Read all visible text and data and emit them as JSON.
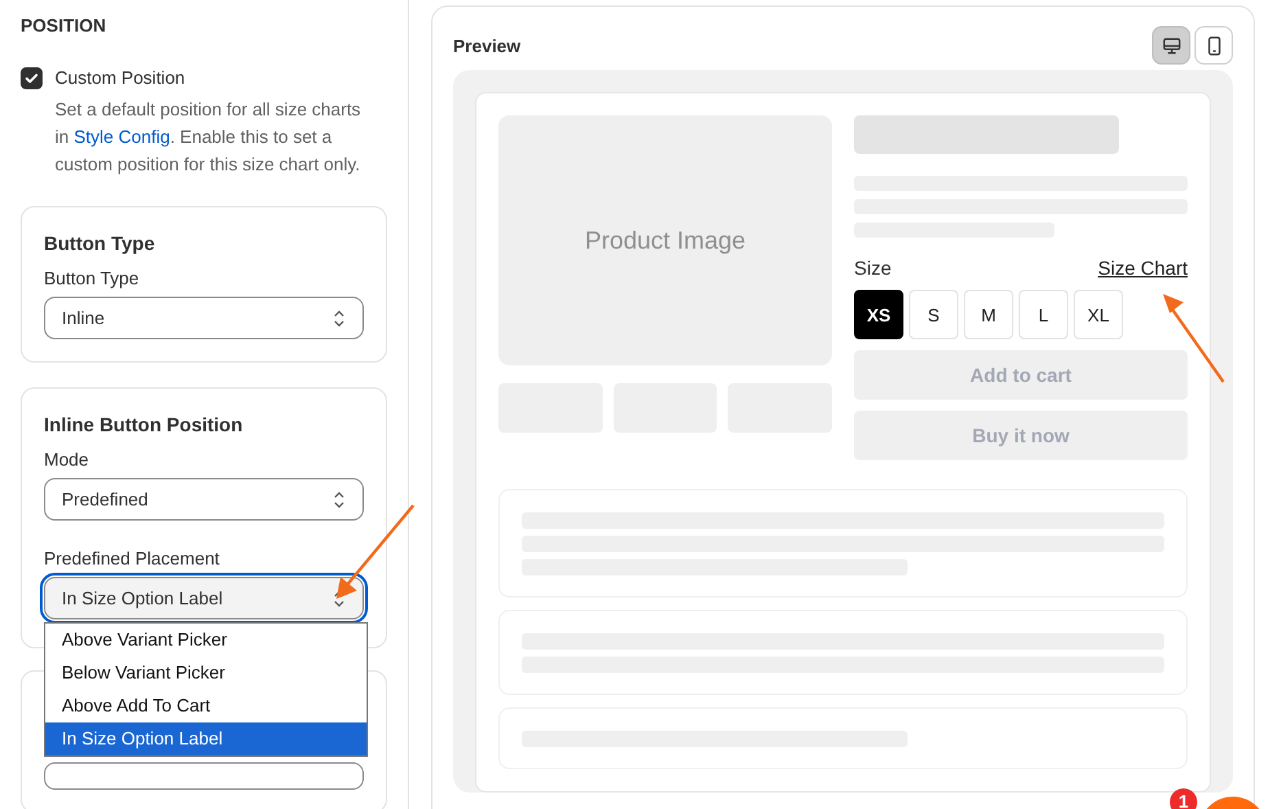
{
  "settings": {
    "section_title": "POSITION",
    "custom_position": {
      "label": "Custom Position",
      "checked": true,
      "description_before": "Set a default position for all size charts in ",
      "link": "Style Config",
      "description_after": ". Enable this to set a custom position for this size chart only."
    },
    "button_type_card": {
      "title": "Button Type",
      "field_label": "Button Type",
      "value": "Inline"
    },
    "inline_position_card": {
      "title": "Inline Button Position",
      "mode_label": "Mode",
      "mode_value": "Predefined",
      "placement_label": "Predefined Placement",
      "placement_value": "In Size Option Label",
      "placement_open": true,
      "options": [
        {
          "label": "Above Variant Picker",
          "selected": false
        },
        {
          "label": "Below Variant Picker",
          "selected": false
        },
        {
          "label": "Above Add To Cart",
          "selected": false
        },
        {
          "label": "In Size Option Label",
          "selected": true
        }
      ]
    }
  },
  "preview": {
    "title": "Preview",
    "devices": [
      {
        "kind": "desktop",
        "selected": true
      },
      {
        "kind": "mobile",
        "selected": false
      }
    ],
    "image_label": "Product Image",
    "size_label": "Size",
    "size_chart_link": "Size Chart",
    "sizes": [
      {
        "label": "XS",
        "selected": true
      },
      {
        "label": "S",
        "selected": false
      },
      {
        "label": "M",
        "selected": false
      },
      {
        "label": "L",
        "selected": false
      },
      {
        "label": "XL",
        "selected": false
      }
    ],
    "add_to_cart": "Add to cart",
    "buy_now": "Buy it now"
  },
  "chat_badge": "1"
}
